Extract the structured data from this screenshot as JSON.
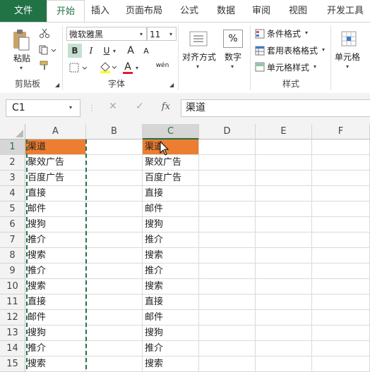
{
  "ribbon_tabs": [
    {
      "label": "文件"
    },
    {
      "label": "开始"
    },
    {
      "label": "插入"
    },
    {
      "label": "页面布局"
    },
    {
      "label": "公式"
    },
    {
      "label": "数据"
    },
    {
      "label": "审阅"
    },
    {
      "label": "视图"
    },
    {
      "label": "开发工具"
    }
  ],
  "clipboard": {
    "paste_label": "粘贴",
    "group_label": "剪贴板"
  },
  "font": {
    "name": "微软雅黑",
    "size": "11",
    "group_label": "字体",
    "bold": "B",
    "italic": "I",
    "underline": "U",
    "grow": "A",
    "shrink": "A",
    "font_color": "A",
    "phonetic": "wén"
  },
  "alignment": {
    "label": "对齐方式"
  },
  "number": {
    "label": "数字",
    "percent": "%"
  },
  "styles": {
    "conditional": "条件格式",
    "table_format": "套用表格格式",
    "cell_styles": "单元格样式",
    "group_label": "样式"
  },
  "cells": {
    "label": "单元格"
  },
  "formula_bar": {
    "name_box": "C1",
    "fx": "fx",
    "cancel": "✕",
    "enter": "✓",
    "content": "渠道"
  },
  "colors": {
    "accent": "#217346",
    "highlight": "#ed7d31"
  },
  "columns": [
    "A",
    "B",
    "C",
    "D",
    "E",
    "F"
  ],
  "rows": [
    {
      "n": "1",
      "a": "渠道",
      "c": "渠道"
    },
    {
      "n": "2",
      "a": "聚效广告",
      "c": "聚效广告"
    },
    {
      "n": "3",
      "a": "百度广告",
      "c": "百度广告"
    },
    {
      "n": "4",
      "a": "直接",
      "c": "直接"
    },
    {
      "n": "5",
      "a": "邮件",
      "c": "邮件"
    },
    {
      "n": "6",
      "a": "搜狗",
      "c": "搜狗"
    },
    {
      "n": "7",
      "a": "推介",
      "c": "推介"
    },
    {
      "n": "8",
      "a": "搜索",
      "c": "搜索"
    },
    {
      "n": "9",
      "a": "推介",
      "c": "推介"
    },
    {
      "n": "10",
      "a": "搜索",
      "c": "搜索"
    },
    {
      "n": "11",
      "a": "直接",
      "c": "直接"
    },
    {
      "n": "12",
      "a": "邮件",
      "c": "邮件"
    },
    {
      "n": "13",
      "a": "搜狗",
      "c": "搜狗"
    },
    {
      "n": "14",
      "a": "推介",
      "c": "推介"
    },
    {
      "n": "15",
      "a": "搜索",
      "c": "搜索"
    }
  ]
}
